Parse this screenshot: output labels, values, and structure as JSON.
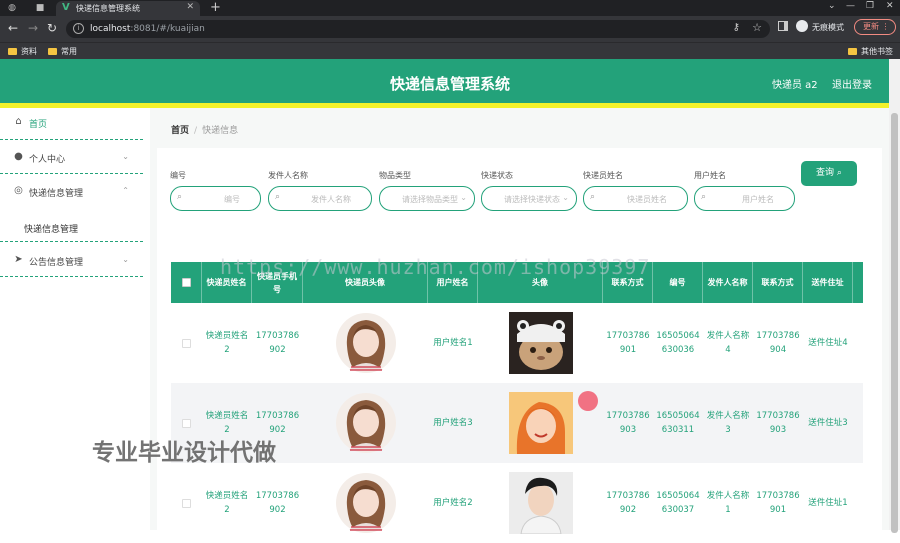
{
  "browser": {
    "tab_title": "快递信息管理系统",
    "url_host": "localhost",
    "url_rest": ":8081/#/kuaijian",
    "profile_label": "无痕模式",
    "update_label": "更新",
    "bookmarks": [
      "资料",
      "常用"
    ],
    "bookmarks_right": "其他书签"
  },
  "header": {
    "title": "快递信息管理系统",
    "user": "快递员 a2",
    "logout": "退出登录"
  },
  "sidebar": {
    "items": [
      {
        "label": "首页",
        "icon": "home-icon"
      },
      {
        "label": "个人中心",
        "icon": "user-icon"
      },
      {
        "label": "快递信息管理",
        "icon": "globe-icon"
      },
      {
        "label": "公告信息管理",
        "icon": "send-icon"
      }
    ],
    "submenu": "快递信息管理"
  },
  "breadcrumb": {
    "home": "首页",
    "current": "快递信息"
  },
  "search": {
    "fields": [
      {
        "label": "编号",
        "placeholder": "编号"
      },
      {
        "label": "发件人名称",
        "placeholder": "发件人名称"
      },
      {
        "label": "物品类型",
        "placeholder": "请选择物品类型"
      },
      {
        "label": "快递状态",
        "placeholder": "请选择快递状态"
      },
      {
        "label": "快递员姓名",
        "placeholder": "快递员姓名"
      },
      {
        "label": "用户姓名",
        "placeholder": "用户姓名"
      }
    ],
    "query_button": "查询"
  },
  "table": {
    "headers": [
      "快递员姓名",
      "快递员手机号",
      "快递员头像",
      "用户姓名",
      "头像",
      "联系方式",
      "编号",
      "发件人名称",
      "联系方式",
      "送件住址"
    ],
    "rows": [
      {
        "courier_name": "快递员姓名2",
        "courier_phone": "17703786902",
        "user_name": "用户姓名1",
        "contact": "17703786901",
        "code": "16505064630036",
        "sender": "发件人名称4",
        "contact2": "17703786904",
        "address": "送件住址4"
      },
      {
        "courier_name": "快递员姓名2",
        "courier_phone": "17703786902",
        "user_name": "用户姓名3",
        "contact": "17703786903",
        "code": "16505064630311",
        "sender": "发件人名称3",
        "contact2": "17703786903",
        "address": "送件住址3"
      },
      {
        "courier_name": "快递员姓名2",
        "courier_phone": "17703786902",
        "user_name": "用户姓名2",
        "contact": "17703786902",
        "code": "16505064630037",
        "sender": "发件人名称1",
        "contact2": "17703786901",
        "address": "送件住址1"
      }
    ]
  },
  "overlay": {
    "watermark": "https://www.huzhan.com/ishop39397",
    "caption": "专业毕业设计代做"
  },
  "colors": {
    "primary": "#23a27a",
    "accent_bar": "#f2f22a"
  }
}
